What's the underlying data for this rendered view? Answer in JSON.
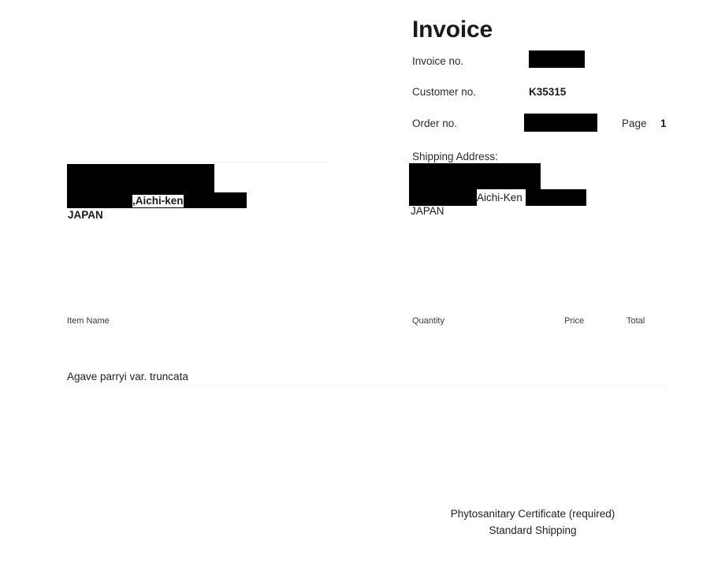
{
  "document": {
    "title": "Invoice",
    "background_color": "#ffffff",
    "text_color": "#231f20",
    "redaction_color": "#000000"
  },
  "header": {
    "invoice_no_label": "Invoice no.",
    "invoice_no_value": "",
    "customer_no_label": "Customer no.",
    "customer_no_value": "K35315",
    "order_no_label": "Order no.",
    "order_no_value": "",
    "page_label": "Page",
    "page_value": "1"
  },
  "shipping_address": {
    "label": "Shipping Address:",
    "line_region": "Aichi-Ken",
    "country": "JAPAN"
  },
  "billing_address": {
    "line_region": ",Aichi-ken",
    "country": "JAPAN"
  },
  "items_table": {
    "columns": {
      "item_name": "Item Name",
      "quantity": "Quantity",
      "price": "Price",
      "total": "Total"
    },
    "rows": [
      {
        "item_name": "Agave parryi var. truncata",
        "quantity": "",
        "price": "",
        "total": ""
      }
    ]
  },
  "footer": {
    "lines": [
      "Phytosanitary Certificate (required)",
      "Standard Shipping"
    ]
  }
}
